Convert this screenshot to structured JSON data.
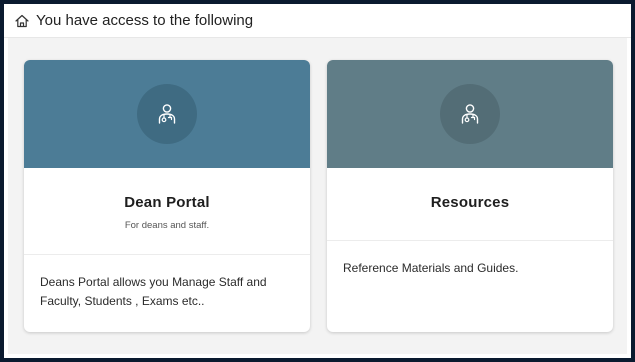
{
  "header": {
    "title": "You have access to the following",
    "icon": "home-icon"
  },
  "cards": [
    {
      "title": "Dean Portal",
      "subtitle": "For deans and staff.",
      "description": "Deans Portal allows you Manage Staff and Faculty, Students , Exams etc..",
      "icon": "doctor-icon",
      "banner_color": "#4c7c96"
    },
    {
      "title": "Resources",
      "subtitle": "",
      "description": "Reference Materials and Guides.",
      "icon": "doctor-icon",
      "banner_color": "#607d87"
    }
  ]
}
